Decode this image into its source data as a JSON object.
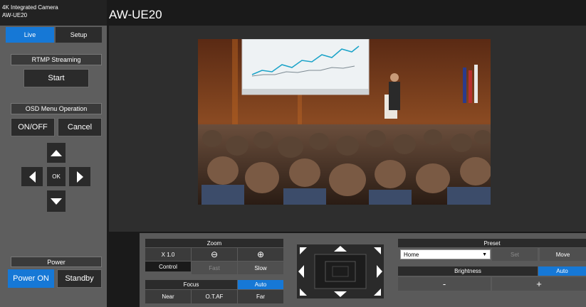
{
  "app": {
    "brand_line1": "4K Integrated Camera",
    "brand_line2": "AW-UE20",
    "title": "AW-UE20"
  },
  "tabs": {
    "live": "Live",
    "setup": "Setup"
  },
  "rtmp": {
    "label": "RTMP Streaming",
    "start": "Start"
  },
  "osd": {
    "label": "OSD Menu Operation",
    "onoff": "ON/OFF",
    "cancel": "Cancel",
    "ok": "OK"
  },
  "power": {
    "label": "Power",
    "on": "Power ON",
    "standby": "Standby"
  },
  "zoom": {
    "label": "Zoom",
    "value": "X 1.0",
    "control": "Control",
    "fast": "Fast",
    "slow": "Slow",
    "zoom_out_icon": "zoom-out-icon",
    "zoom_in_icon": "zoom-in-icon"
  },
  "focus": {
    "label": "Focus",
    "auto": "Auto",
    "near": "Near",
    "otaf": "O.T.AF",
    "far": "Far"
  },
  "preset": {
    "label": "Preset",
    "selected": "Home",
    "set": "Set",
    "move": "Move"
  },
  "brightness": {
    "label": "Brightness",
    "auto": "Auto",
    "minus": "-",
    "plus": "+"
  },
  "colors": {
    "accent": "#1678d6",
    "panel": "#5e5e5e",
    "background": "#1a1a1a"
  }
}
